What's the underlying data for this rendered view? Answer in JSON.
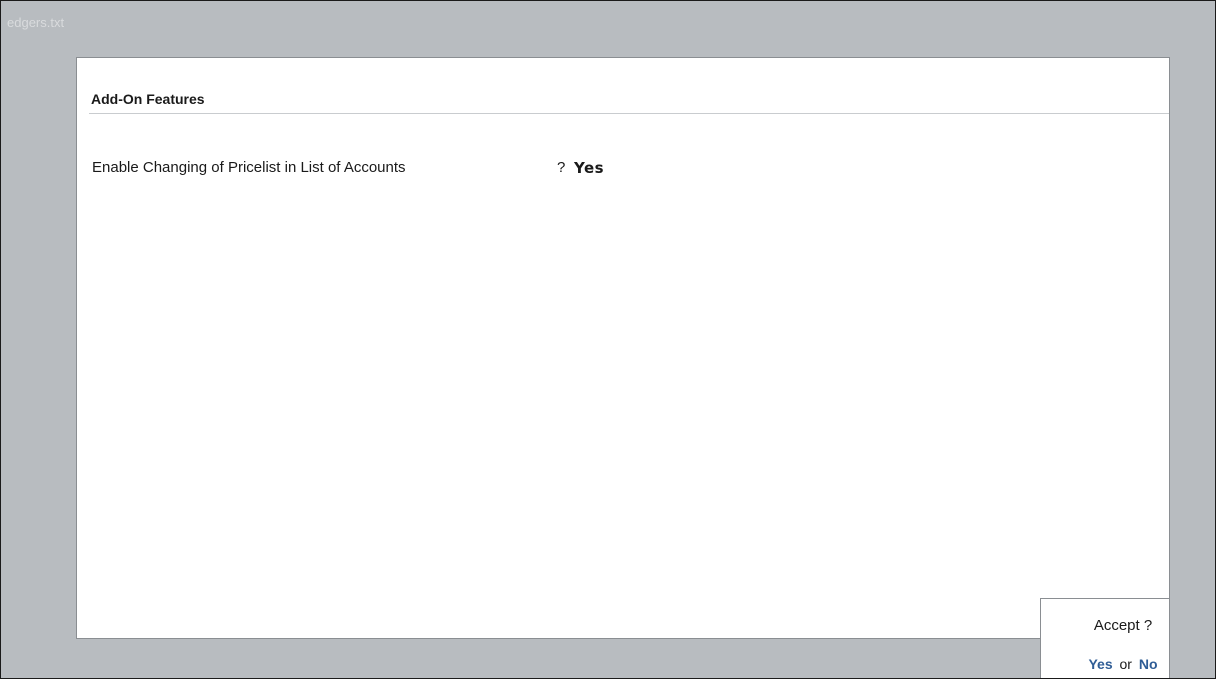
{
  "background": {
    "filename": "edgers.txt"
  },
  "panel": {
    "title": "Add-On Features",
    "fields": [
      {
        "label": "Enable Changing of Pricelist in List of Accounts",
        "separator": "?",
        "value": "Yes"
      }
    ]
  },
  "accept_dialog": {
    "question": "Accept ?",
    "yes_label": "Yes",
    "or_label": "or",
    "no_label": "No"
  },
  "colors": {
    "background": "#b8bcc0",
    "panel": "#ffffff",
    "option_accent": "#2f5d96"
  }
}
